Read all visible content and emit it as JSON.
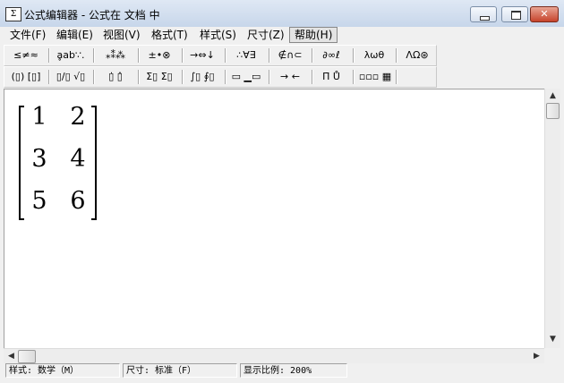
{
  "window": {
    "title": "公式编辑器 - 公式在 文档 中",
    "app_icon_glyph": "Σ",
    "controls": {
      "minimize": "minimize-icon",
      "maximize": "maximize-icon",
      "close": "✕"
    }
  },
  "menu": [
    "文件(F)",
    "编辑(E)",
    "视图(V)",
    "格式(T)",
    "样式(S)",
    "尺寸(Z)",
    "帮助(H)"
  ],
  "menu_active_index": 6,
  "toolbar_row1": [
    "≤≠≈",
    "ḁab∵.",
    "⁎⁑⁂",
    "±•⊗",
    "→⇔↓",
    "∴∀∃",
    "∉∩⊂",
    "∂∞ℓ",
    "λωθ",
    "ΛΩ⊛"
  ],
  "toolbar_row2": [
    "(▯) [▯]",
    "▯/▯ √▯",
    "▯̇ ▯̂",
    "Σ▯ Σ▯",
    "∫▯ ∮▯",
    "▭ ▁▭",
    "→ ←",
    "Π̈ Ů",
    "▫▫▫ ▦"
  ],
  "matrix": {
    "rows": [
      [
        "1",
        "2"
      ],
      [
        "3",
        "4"
      ],
      [
        "5",
        "6"
      ]
    ]
  },
  "scrollbars": {
    "up": "▲",
    "down": "▼",
    "left": "◀",
    "right": "▶"
  },
  "status": {
    "style": "样式: 数学（M）",
    "size": "尺寸: 标准（F）",
    "zoom": "显示比例: 200%"
  }
}
